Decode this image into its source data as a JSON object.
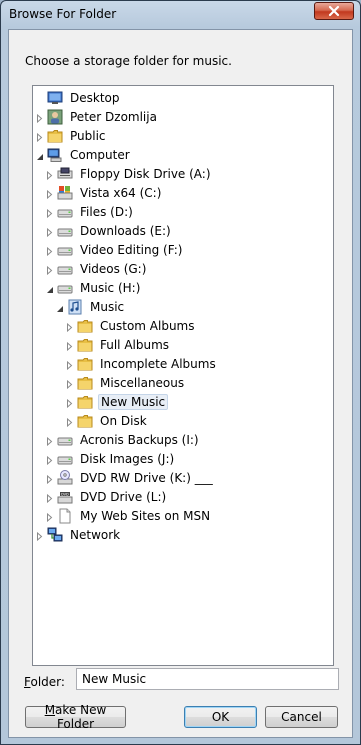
{
  "window": {
    "title": "Browse For Folder",
    "close_icon": "close-icon"
  },
  "dialog": {
    "prompt": "Choose a storage folder for music."
  },
  "tree": {
    "selected": "New Music",
    "items": [
      {
        "label": "Desktop",
        "icon": "desktop-icon",
        "level": 0,
        "expander": "none"
      },
      {
        "label": "Peter Dzomlija",
        "icon": "user-folder-icon",
        "level": 0,
        "expander": "collapsed"
      },
      {
        "label": "Public",
        "icon": "folder-icon",
        "level": 0,
        "expander": "collapsed"
      },
      {
        "label": "Computer",
        "icon": "computer-icon",
        "level": 0,
        "expander": "expanded"
      },
      {
        "label": "Floppy Disk Drive (A:)",
        "icon": "floppy-drive-icon",
        "level": 1,
        "expander": "collapsed"
      },
      {
        "label": "Vista x64 (C:)",
        "icon": "system-drive-icon",
        "level": 1,
        "expander": "collapsed"
      },
      {
        "label": "Files (D:)",
        "icon": "hard-drive-icon",
        "level": 1,
        "expander": "collapsed"
      },
      {
        "label": "Downloads (E:)",
        "icon": "hard-drive-icon",
        "level": 1,
        "expander": "collapsed"
      },
      {
        "label": "Video Editing (F:)",
        "icon": "hard-drive-icon",
        "level": 1,
        "expander": "collapsed"
      },
      {
        "label": "Videos (G:)",
        "icon": "hard-drive-icon",
        "level": 1,
        "expander": "collapsed"
      },
      {
        "label": "Music (H:)",
        "icon": "hard-drive-icon",
        "level": 1,
        "expander": "expanded"
      },
      {
        "label": "Music",
        "icon": "music-library-icon",
        "level": 2,
        "expander": "expanded"
      },
      {
        "label": "Custom Albums",
        "icon": "folder-icon",
        "level": 3,
        "expander": "collapsed"
      },
      {
        "label": "Full Albums",
        "icon": "folder-icon",
        "level": 3,
        "expander": "collapsed"
      },
      {
        "label": "Incomplete Albums",
        "icon": "folder-icon",
        "level": 3,
        "expander": "collapsed"
      },
      {
        "label": "Miscellaneous",
        "icon": "folder-icon",
        "level": 3,
        "expander": "collapsed"
      },
      {
        "label": "New Music",
        "icon": "folder-icon",
        "level": 3,
        "expander": "collapsed"
      },
      {
        "label": "On Disk",
        "icon": "folder-icon",
        "level": 3,
        "expander": "collapsed"
      },
      {
        "label": "Acronis Backups (I:)",
        "icon": "hard-drive-icon",
        "level": 1,
        "expander": "collapsed"
      },
      {
        "label": "Disk Images (J:)",
        "icon": "hard-drive-icon",
        "level": 1,
        "expander": "collapsed"
      },
      {
        "label": "DVD RW Drive (K:) ___",
        "icon": "dvd-rw-drive-icon",
        "level": 1,
        "expander": "collapsed"
      },
      {
        "label": "DVD Drive (L:)",
        "icon": "dvd-drive-icon",
        "level": 1,
        "expander": "collapsed"
      },
      {
        "label": "My Web Sites on MSN",
        "icon": "document-icon",
        "level": 1,
        "expander": "collapsed"
      },
      {
        "label": "Network",
        "icon": "network-icon",
        "level": 0,
        "expander": "collapsed"
      }
    ]
  },
  "folder": {
    "label_prefix": "F",
    "label_rest": "older:",
    "value": "New Music"
  },
  "buttons": {
    "make_new_folder_prefix": "M",
    "make_new_folder_rest": "ake New Folder",
    "ok": "OK",
    "cancel": "Cancel"
  }
}
